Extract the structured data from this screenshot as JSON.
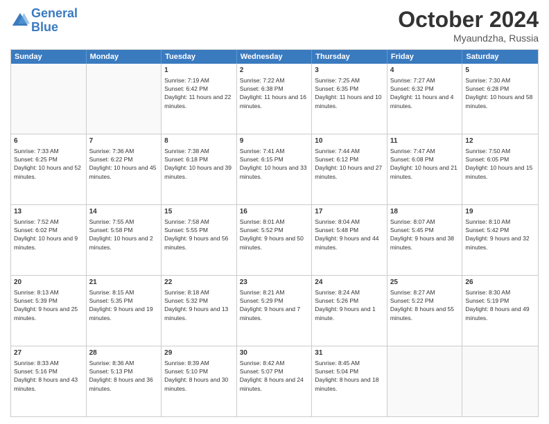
{
  "header": {
    "logo_line1": "General",
    "logo_line2": "Blue",
    "month": "October 2024",
    "location": "Myaundzha, Russia"
  },
  "days_of_week": [
    "Sunday",
    "Monday",
    "Tuesday",
    "Wednesday",
    "Thursday",
    "Friday",
    "Saturday"
  ],
  "weeks": [
    [
      {
        "day": "",
        "empty": true
      },
      {
        "day": "",
        "empty": true
      },
      {
        "day": "1",
        "sunrise": "Sunrise: 7:19 AM",
        "sunset": "Sunset: 6:42 PM",
        "daylight": "Daylight: 11 hours and 22 minutes."
      },
      {
        "day": "2",
        "sunrise": "Sunrise: 7:22 AM",
        "sunset": "Sunset: 6:38 PM",
        "daylight": "Daylight: 11 hours and 16 minutes."
      },
      {
        "day": "3",
        "sunrise": "Sunrise: 7:25 AM",
        "sunset": "Sunset: 6:35 PM",
        "daylight": "Daylight: 11 hours and 10 minutes."
      },
      {
        "day": "4",
        "sunrise": "Sunrise: 7:27 AM",
        "sunset": "Sunset: 6:32 PM",
        "daylight": "Daylight: 11 hours and 4 minutes."
      },
      {
        "day": "5",
        "sunrise": "Sunrise: 7:30 AM",
        "sunset": "Sunset: 6:28 PM",
        "daylight": "Daylight: 10 hours and 58 minutes."
      }
    ],
    [
      {
        "day": "6",
        "sunrise": "Sunrise: 7:33 AM",
        "sunset": "Sunset: 6:25 PM",
        "daylight": "Daylight: 10 hours and 52 minutes."
      },
      {
        "day": "7",
        "sunrise": "Sunrise: 7:36 AM",
        "sunset": "Sunset: 6:22 PM",
        "daylight": "Daylight: 10 hours and 45 minutes."
      },
      {
        "day": "8",
        "sunrise": "Sunrise: 7:38 AM",
        "sunset": "Sunset: 6:18 PM",
        "daylight": "Daylight: 10 hours and 39 minutes."
      },
      {
        "day": "9",
        "sunrise": "Sunrise: 7:41 AM",
        "sunset": "Sunset: 6:15 PM",
        "daylight": "Daylight: 10 hours and 33 minutes."
      },
      {
        "day": "10",
        "sunrise": "Sunrise: 7:44 AM",
        "sunset": "Sunset: 6:12 PM",
        "daylight": "Daylight: 10 hours and 27 minutes."
      },
      {
        "day": "11",
        "sunrise": "Sunrise: 7:47 AM",
        "sunset": "Sunset: 6:08 PM",
        "daylight": "Daylight: 10 hours and 21 minutes."
      },
      {
        "day": "12",
        "sunrise": "Sunrise: 7:50 AM",
        "sunset": "Sunset: 6:05 PM",
        "daylight": "Daylight: 10 hours and 15 minutes."
      }
    ],
    [
      {
        "day": "13",
        "sunrise": "Sunrise: 7:52 AM",
        "sunset": "Sunset: 6:02 PM",
        "daylight": "Daylight: 10 hours and 9 minutes."
      },
      {
        "day": "14",
        "sunrise": "Sunrise: 7:55 AM",
        "sunset": "Sunset: 5:58 PM",
        "daylight": "Daylight: 10 hours and 2 minutes."
      },
      {
        "day": "15",
        "sunrise": "Sunrise: 7:58 AM",
        "sunset": "Sunset: 5:55 PM",
        "daylight": "Daylight: 9 hours and 56 minutes."
      },
      {
        "day": "16",
        "sunrise": "Sunrise: 8:01 AM",
        "sunset": "Sunset: 5:52 PM",
        "daylight": "Daylight: 9 hours and 50 minutes."
      },
      {
        "day": "17",
        "sunrise": "Sunrise: 8:04 AM",
        "sunset": "Sunset: 5:48 PM",
        "daylight": "Daylight: 9 hours and 44 minutes."
      },
      {
        "day": "18",
        "sunrise": "Sunrise: 8:07 AM",
        "sunset": "Sunset: 5:45 PM",
        "daylight": "Daylight: 9 hours and 38 minutes."
      },
      {
        "day": "19",
        "sunrise": "Sunrise: 8:10 AM",
        "sunset": "Sunset: 5:42 PM",
        "daylight": "Daylight: 9 hours and 32 minutes."
      }
    ],
    [
      {
        "day": "20",
        "sunrise": "Sunrise: 8:13 AM",
        "sunset": "Sunset: 5:39 PM",
        "daylight": "Daylight: 9 hours and 25 minutes."
      },
      {
        "day": "21",
        "sunrise": "Sunrise: 8:15 AM",
        "sunset": "Sunset: 5:35 PM",
        "daylight": "Daylight: 9 hours and 19 minutes."
      },
      {
        "day": "22",
        "sunrise": "Sunrise: 8:18 AM",
        "sunset": "Sunset: 5:32 PM",
        "daylight": "Daylight: 9 hours and 13 minutes."
      },
      {
        "day": "23",
        "sunrise": "Sunrise: 8:21 AM",
        "sunset": "Sunset: 5:29 PM",
        "daylight": "Daylight: 9 hours and 7 minutes."
      },
      {
        "day": "24",
        "sunrise": "Sunrise: 8:24 AM",
        "sunset": "Sunset: 5:26 PM",
        "daylight": "Daylight: 9 hours and 1 minute."
      },
      {
        "day": "25",
        "sunrise": "Sunrise: 8:27 AM",
        "sunset": "Sunset: 5:22 PM",
        "daylight": "Daylight: 8 hours and 55 minutes."
      },
      {
        "day": "26",
        "sunrise": "Sunrise: 8:30 AM",
        "sunset": "Sunset: 5:19 PM",
        "daylight": "Daylight: 8 hours and 49 minutes."
      }
    ],
    [
      {
        "day": "27",
        "sunrise": "Sunrise: 8:33 AM",
        "sunset": "Sunset: 5:16 PM",
        "daylight": "Daylight: 8 hours and 43 minutes."
      },
      {
        "day": "28",
        "sunrise": "Sunrise: 8:36 AM",
        "sunset": "Sunset: 5:13 PM",
        "daylight": "Daylight: 8 hours and 36 minutes."
      },
      {
        "day": "29",
        "sunrise": "Sunrise: 8:39 AM",
        "sunset": "Sunset: 5:10 PM",
        "daylight": "Daylight: 8 hours and 30 minutes."
      },
      {
        "day": "30",
        "sunrise": "Sunrise: 8:42 AM",
        "sunset": "Sunset: 5:07 PM",
        "daylight": "Daylight: 8 hours and 24 minutes."
      },
      {
        "day": "31",
        "sunrise": "Sunrise: 8:45 AM",
        "sunset": "Sunset: 5:04 PM",
        "daylight": "Daylight: 8 hours and 18 minutes."
      },
      {
        "day": "",
        "empty": true
      },
      {
        "day": "",
        "empty": true
      }
    ]
  ]
}
